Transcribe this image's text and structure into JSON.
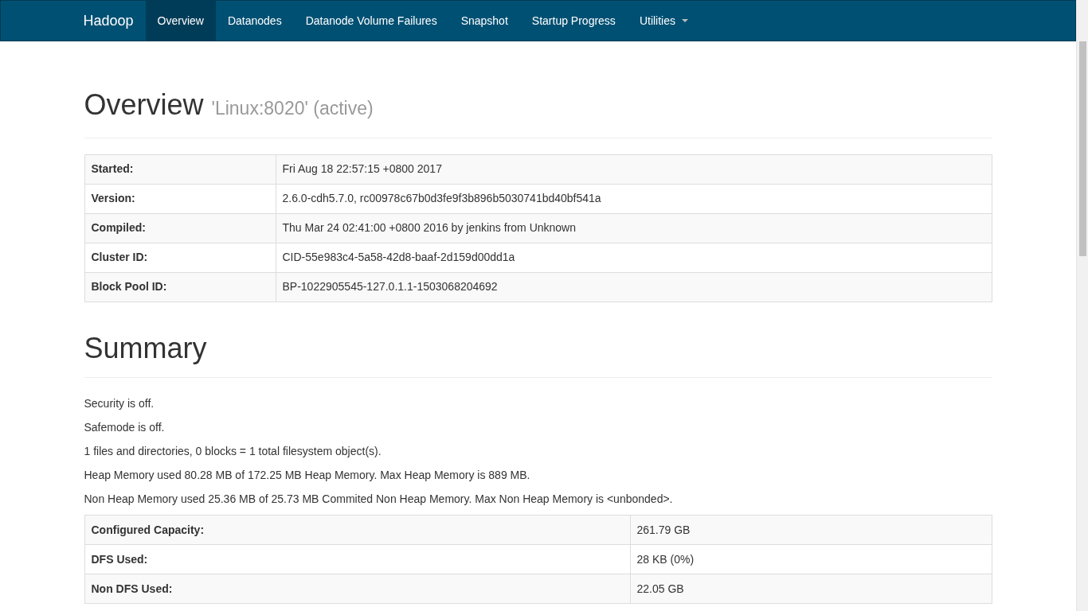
{
  "navbar": {
    "brand": "Hadoop",
    "items": [
      {
        "label": "Overview",
        "selected": true,
        "dropdown": false
      },
      {
        "label": "Datanodes",
        "selected": false,
        "dropdown": false
      },
      {
        "label": "Datanode Volume Failures",
        "selected": false,
        "dropdown": false
      },
      {
        "label": "Snapshot",
        "selected": false,
        "dropdown": false
      },
      {
        "label": "Startup Progress",
        "selected": false,
        "dropdown": false
      },
      {
        "label": "Utilities",
        "selected": false,
        "dropdown": true
      }
    ]
  },
  "overview": {
    "title": "Overview",
    "subtitle": "'Linux:8020' (active)",
    "rows": [
      {
        "label": "Started:",
        "value": "Fri Aug 18 22:57:15 +0800 2017"
      },
      {
        "label": "Version:",
        "value": "2.6.0-cdh5.7.0, rc00978c67b0d3fe9f3b896b5030741bd40bf541a"
      },
      {
        "label": "Compiled:",
        "value": "Thu Mar 24 02:41:00 +0800 2016 by jenkins from Unknown"
      },
      {
        "label": "Cluster ID:",
        "value": "CID-55e983c4-5a58-42d8-baaf-2d159d00dd1a"
      },
      {
        "label": "Block Pool ID:",
        "value": "BP-1022905545-127.0.1.1-1503068204692"
      }
    ]
  },
  "summary": {
    "title": "Summary",
    "lines": [
      "Security is off.",
      "Safemode is off.",
      "1 files and directories, 0 blocks = 1 total filesystem object(s).",
      "Heap Memory used 80.28 MB of 172.25 MB Heap Memory. Max Heap Memory is 889 MB.",
      "Non Heap Memory used 25.36 MB of 25.73 MB Commited Non Heap Memory. Max Non Heap Memory is <unbonded>."
    ],
    "rows": [
      {
        "label": "Configured Capacity:",
        "value": "261.79 GB"
      },
      {
        "label": "DFS Used:",
        "value": "28 KB (0%)"
      },
      {
        "label": "Non DFS Used:",
        "value": "22.05 GB"
      }
    ]
  }
}
